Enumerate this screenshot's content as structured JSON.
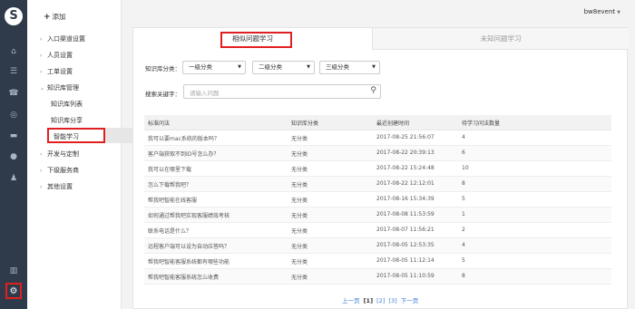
{
  "header": {
    "username": "bw8event"
  },
  "subnav": {
    "add_label": "添加",
    "items": [
      {
        "label": "入口渠道设置",
        "arrow": "›"
      },
      {
        "label": "人员设置",
        "arrow": "›"
      },
      {
        "label": "工单设置",
        "arrow": "›"
      },
      {
        "label": "知识库管理",
        "arrow": "⌄"
      },
      {
        "label": "开发与定制",
        "arrow": "›"
      },
      {
        "label": "下级服务商",
        "arrow": "›"
      },
      {
        "label": "其他设置",
        "arrow": "›"
      }
    ],
    "sub_items": [
      "知识库列表",
      "知识库分享",
      "智能学习"
    ]
  },
  "tabs": [
    "相似问题学习",
    "未知问题学习"
  ],
  "filters": {
    "category_label": "知识库分类：",
    "level1": "一级分类",
    "level2": "二级分类",
    "level3": "三级分类",
    "keyword_label": "搜索关键字：",
    "keyword_placeholder": "请输入问题"
  },
  "table": {
    "headers": [
      "标准问法",
      "知识库分类",
      "最近创建时间",
      "待学习问法数量"
    ],
    "rows": [
      [
        "我可以要mac系统的版本吗？",
        "无分类",
        "2017-08-25 21:56:07",
        "4"
      ],
      [
        "客户端获取不到ID号怎么办？",
        "无分类",
        "2017-08-22 20:39:13",
        "6"
      ],
      [
        "我可以在哪里下载",
        "无分类",
        "2017-08-22 15:24:48",
        "10"
      ],
      [
        "怎么下载帮我吧？",
        "无分类",
        "2017-08-22 12:12:01",
        "8"
      ],
      [
        "帮我吧智能在线客服",
        "无分类",
        "2017-08-16 15:34:39",
        "5"
      ],
      [
        "如何通过帮我吧实现客服绩效考核",
        "无分类",
        "2017-08-08 11:53:59",
        "1"
      ],
      [
        "联系电话是什么？",
        "无分类",
        "2017-08-07 11:56:21",
        "2"
      ],
      [
        "远程客户端可以设为自动应答吗？",
        "无分类",
        "2017-08-05 12:53:35",
        "4"
      ],
      [
        "帮我吧智能客服系统都有哪些功能",
        "无分类",
        "2017-08-05 11:12:14",
        "5"
      ],
      [
        "帮我吧智能客服系统怎么收费",
        "无分类",
        "2017-08-05 11:10:59",
        "8"
      ]
    ]
  },
  "pager": {
    "prev": "上一页",
    "pages": [
      "[1]",
      "[2]",
      "[3]"
    ],
    "next": "下一页"
  },
  "icons": [
    "logo-icon",
    "home-icon",
    "list-icon",
    "settings-icon",
    "phone-icon",
    "chart-icon",
    "folder-icon",
    "user-icon",
    "user-group-icon",
    "bar-chart-icon",
    "gear-icon"
  ]
}
